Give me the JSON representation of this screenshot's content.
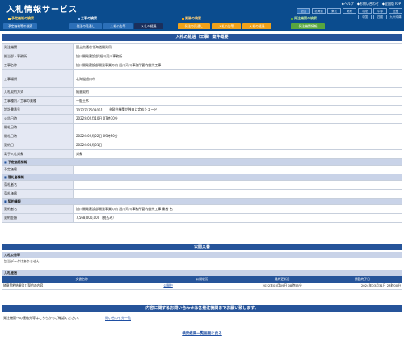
{
  "header": {
    "title": "入札情報サービス",
    "links": [
      "ヘルプ",
      "お問い合わせ",
      "全国版TOP"
    ],
    "regions": [
      "全国",
      "北海道",
      "東北",
      "関東",
      "北陸",
      "中部",
      "近畿"
    ],
    "prefixes": [
      "中国",
      "四国",
      "九州沖縄"
    ]
  },
  "nav": {
    "group1": "予定価格の検索",
    "group1_sub": "予定価格等の検索",
    "group2": "工事の検索",
    "group3": "業務の検索",
    "group4": "発注機関の検索",
    "tabs": [
      "発注の見通し",
      "入札公告等",
      "入札の経過",
      "発注の見通し",
      "入札公告等",
      "入札の経過",
      "発注機関情報"
    ],
    "colors": {
      "blue": "#2b6fb8",
      "orange": "#f0a21a",
      "green": "#58a63e",
      "active": "#1b2f5c"
    }
  },
  "main": {
    "section_title": "入札の経過（工事）案件概要",
    "rows": [
      {
        "label": "発注機関",
        "value": "国土交通省北海道開発局"
      },
      {
        "label": "担当部・事務所",
        "value": "旭川開発建設部 旭川河川事務所"
      },
      {
        "label": "工事名称",
        "value": "旭川開発建設部開発事業の内 旭川河川事務所管内維持工事"
      },
      {
        "label": "工事場所",
        "value": "北海道旭川市"
      },
      {
        "label": "入札契約方式",
        "value": "随意契約"
      },
      {
        "label": "工事種別／工事の業種",
        "value": "一般土木"
      },
      {
        "label": "設計書番号",
        "value": "2022217503051",
        "note": "※発注機関が独自に定めたコード"
      },
      {
        "label": "公告日時",
        "value": "2022年02月10日 07時30分"
      },
      {
        "label": "開札日時",
        "value": ""
      },
      {
        "label": "開札日時",
        "value": "2022年02月22日 09時50分"
      },
      {
        "label": "契約日",
        "value": "2022年03月01日"
      },
      {
        "label": "電子入札対象",
        "value": "対象"
      }
    ],
    "sub_estimate": "予定価格情報",
    "estimate_rows": [
      {
        "label": "予定価格",
        "value": ""
      }
    ],
    "sub_bidder": "落札者情報",
    "bidder_rows": [
      {
        "label": "落札者名",
        "value": ""
      },
      {
        "label": "落札価格",
        "value": ""
      }
    ],
    "sub_contract": "契約情報",
    "contract_rows": [
      {
        "label": "契約者名",
        "value": "旭川開発建設部開発事業の内 旭川河川事務所管内維持工事 業者 名"
      },
      {
        "label": "契約金額",
        "value": "7,568,000,000（税込み）"
      }
    ]
  },
  "docs": {
    "section_title": "公開文書",
    "notice_header": "入札公告等",
    "notice_text": "該当データはありません",
    "progress_header": "入札経過",
    "table_headers": [
      "文書名称",
      "公開状況",
      "最終更新日",
      "掲載終了日"
    ],
    "table_rows": [
      {
        "name": "随意契約結果及び契約の内容",
        "status": "公開中",
        "updated": "2022年03月09日 08時55分",
        "end": "2024年03月31日 23時00分"
      }
    ]
  },
  "footer": {
    "contact_bar": "内容に関するお問い合わせは各発注機関までお願い致します。",
    "contact_left": "発注機関への連絡先等はこちらからご確認ください。",
    "contact_link": "問い合わせ先一覧",
    "back_link": "検索結果一覧画面に戻る"
  }
}
